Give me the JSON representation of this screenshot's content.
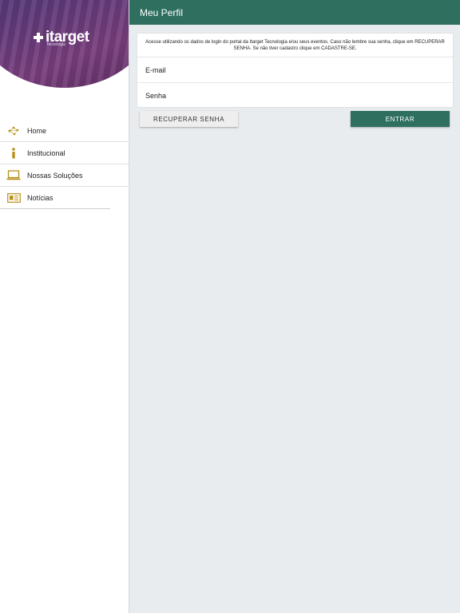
{
  "brand": {
    "logo_text": "itarget",
    "logo_subtext": "Tecnologia"
  },
  "sidebar": {
    "items": [
      {
        "label": "Home",
        "icon": "network-icon"
      },
      {
        "label": "Institucional",
        "icon": "info-icon"
      },
      {
        "label": "Nossas Soluções",
        "icon": "laptop-icon"
      },
      {
        "label": "Notícias",
        "icon": "newspaper-icon"
      }
    ]
  },
  "header": {
    "title": "Meu Perfil"
  },
  "form": {
    "intro": "Acesse utilizando os dados de login do portal da Itarget Tecnologia e/ou seus eventos. Caso não lembre sua senha, clique em RECUPERAR SENHA. Se não tiver cadastro clique em CADASTRE-SE.",
    "email_placeholder": "E-mail",
    "password_placeholder": "Senha",
    "recover_label": "RECUPERAR SENHA",
    "enter_label": "ENTRAR"
  },
  "colors": {
    "primary": "#2e6f60",
    "icon_gold": "#b8911a",
    "background": "#e9ecef"
  }
}
